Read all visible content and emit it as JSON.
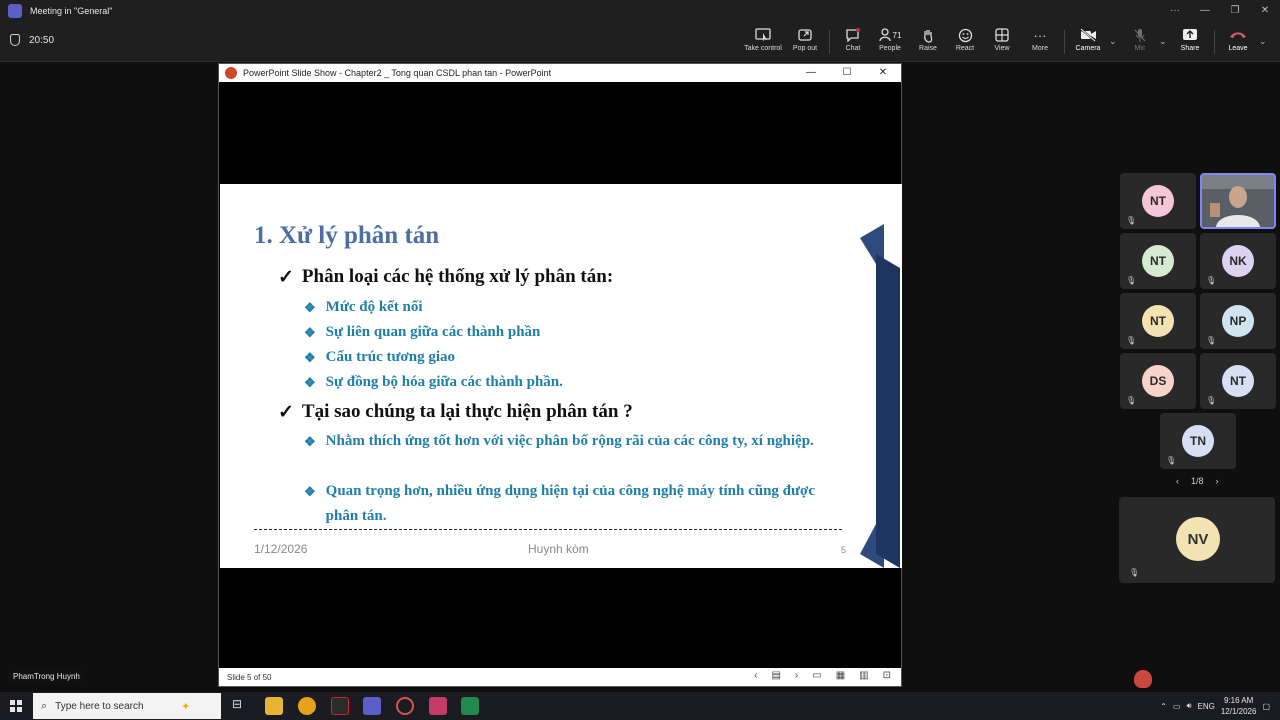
{
  "window": {
    "title": "Meeting in \"General\""
  },
  "meeting": {
    "timer": "20:50",
    "toolbar": [
      {
        "name": "take-control-button",
        "label": "Take control"
      },
      {
        "name": "pop-out-button",
        "label": "Pop out"
      },
      {
        "name": "chat-button",
        "label": "Chat"
      },
      {
        "name": "people-button",
        "label": "People",
        "count": "71"
      },
      {
        "name": "raise-button",
        "label": "Raise"
      },
      {
        "name": "react-button",
        "label": "React"
      },
      {
        "name": "view-button",
        "label": "View"
      },
      {
        "name": "more-button",
        "label": "More"
      },
      {
        "name": "camera-button",
        "label": "Camera"
      },
      {
        "name": "mic-button",
        "label": "Mic"
      },
      {
        "name": "share-button",
        "label": "Share"
      },
      {
        "name": "leave-button",
        "label": "Leave"
      }
    ]
  },
  "ppt": {
    "window_title": "PowerPoint Slide Show  -  Chapter2 _ Tong quan CSDL phan tan - PowerPoint",
    "status": "Slide 5 of 50",
    "slide": {
      "title": "1. Xử lý phân tán",
      "point1": "Phân loại các hệ thống xử lý phân tán:",
      "sub1": [
        "Mức độ kết nối",
        "Sự liên quan giữa các thành phần",
        "Cấu trúc tương giao",
        "Sự đồng bộ hóa giữa các thành phần."
      ],
      "point2": "Tại sao chúng ta lại thực hiện phân tán ?",
      "sub2": [
        "Nhằm thích ứng tốt hơn với việc phân bố rộng rãi của các công ty, xí nghiệp.",
        "Quan trọng hơn, nhiều ứng dụng hiện tại của công nghệ máy tính cũng được phân tán."
      ],
      "check": "✓",
      "diamond": "❖",
      "footer_date": "1/12/2026",
      "footer_author": "Huynh kòm",
      "footer_page": "5"
    }
  },
  "participants": [
    {
      "initials": "NT",
      "color": "#f4c6d7"
    },
    {
      "initials": "",
      "video": true
    },
    {
      "initials": "NT",
      "color": "#d6ead2"
    },
    {
      "initials": "NK",
      "color": "#dcd3f0"
    },
    {
      "initials": "NT",
      "color": "#f3e3b3"
    },
    {
      "initials": "NP",
      "color": "#cfe5ee"
    },
    {
      "initials": "DS",
      "color": "#f6d4c9"
    },
    {
      "initials": "NT",
      "color": "#d7dff2"
    },
    {
      "initials": "TN",
      "color": "#d7dff2"
    }
  ],
  "pager": {
    "text": "1/8"
  },
  "big_participant": {
    "initials": "NV"
  },
  "presenter_name": "PhamTrong Huynh",
  "taskbar": {
    "search_placeholder": "Type here to search",
    "lang": "ENG",
    "time": "9:16 AM",
    "date": "12/1/2026"
  }
}
